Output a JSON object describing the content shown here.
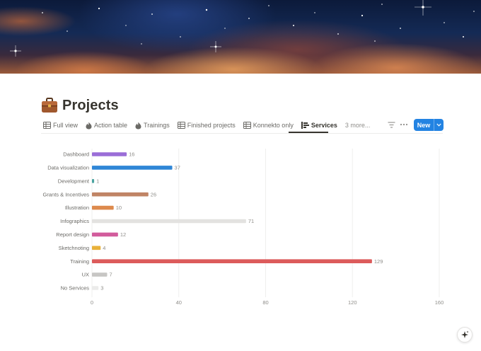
{
  "page": {
    "title": "Projects",
    "title_icon": "briefcase-icon"
  },
  "tabs": [
    {
      "label": "Full view",
      "icon": "table-icon",
      "active": false
    },
    {
      "label": "Action table",
      "icon": "flame-icon",
      "active": false
    },
    {
      "label": "Trainings",
      "icon": "flame-icon",
      "active": false
    },
    {
      "label": "Finished projects",
      "icon": "table-icon",
      "active": false
    },
    {
      "label": "Konnekto only",
      "icon": "table-icon",
      "active": false
    },
    {
      "label": "Services",
      "icon": "bar-chart-icon",
      "active": true
    }
  ],
  "more_tabs_label": "3 more...",
  "toolbar": {
    "filter_icon": "filter-icon",
    "more_icon": "more-options-icon",
    "new_label": "New",
    "new_dropdown_icon": "chevron-down-icon"
  },
  "ai_button_icon": "sparkle-icon",
  "colors": {
    "accent": "#2383e2",
    "active_tab": "#37352f"
  },
  "chart_data": {
    "type": "bar",
    "orientation": "horizontal",
    "categories": [
      "Dashboard",
      "Data visualization",
      "Development",
      "Grants & Incentives",
      "Illustration",
      "Infographics",
      "Report design",
      "Sketchnoting",
      "Training",
      "UX",
      "No Services"
    ],
    "values": [
      16,
      37,
      1,
      26,
      10,
      71,
      12,
      4,
      129,
      7,
      3
    ],
    "colors": [
      "#9a6dd7",
      "#2f86d6",
      "#4aa3a0",
      "#c08465",
      "#dd8a4d",
      "#e3e2e0",
      "#d25c9c",
      "#e8b13a",
      "#dc5b5b",
      "#c7c6c4",
      "#ebebea"
    ],
    "xlim": [
      0,
      160
    ],
    "xticks": [
      0,
      40,
      80,
      120,
      160
    ],
    "grid": true,
    "data_labels": true
  }
}
